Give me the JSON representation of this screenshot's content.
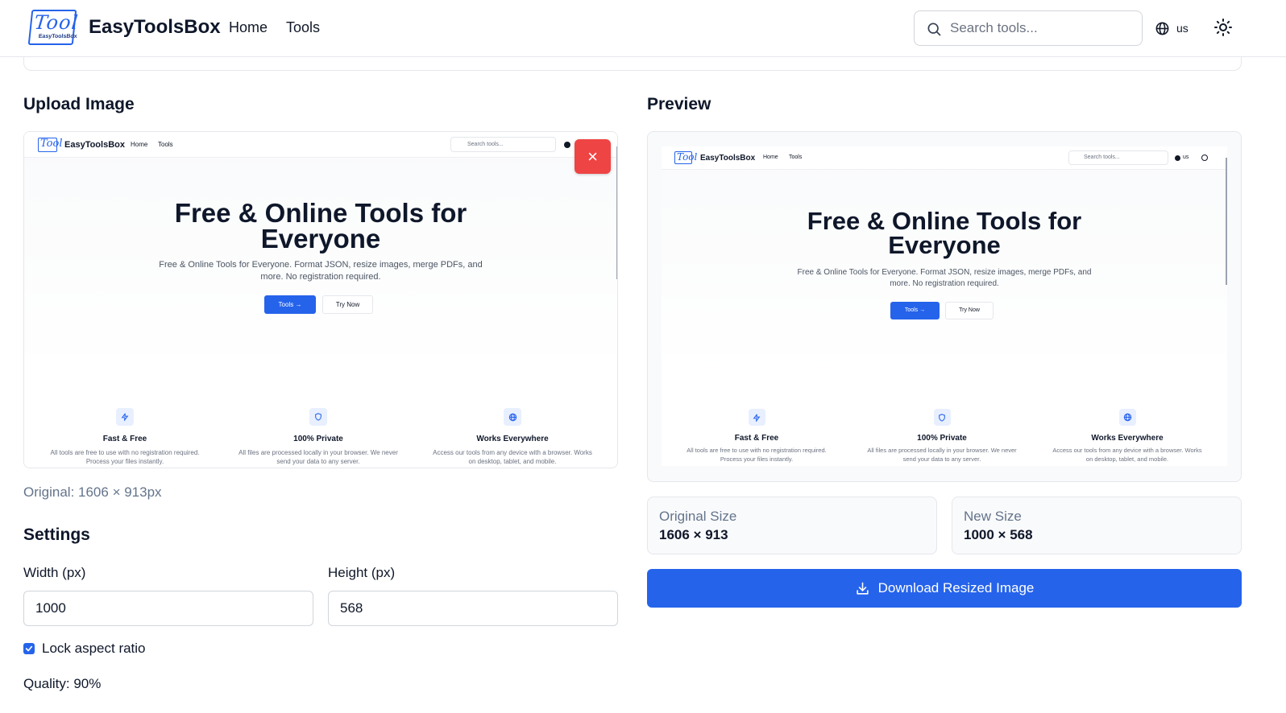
{
  "header": {
    "logo_text": "Tool",
    "logo_subtext": "EasyToolsBox",
    "brand": "EasyToolsBox",
    "nav": [
      {
        "label": "Home"
      },
      {
        "label": "Tools"
      }
    ],
    "search_placeholder": "Search tools...",
    "language": "us"
  },
  "upload": {
    "title": "Upload Image",
    "original_text": "Original: 1606 × 913px",
    "remove_icon": "×"
  },
  "preview": {
    "title": "Preview"
  },
  "screenshot": {
    "logo_text": "Tool",
    "brand": "EasyToolsBox",
    "nav_home": "Home",
    "nav_tools": "Tools",
    "search_placeholder": "Search tools...",
    "lang": "us",
    "hero_title_line1": "Free & Online Tools for",
    "hero_title_line2": "Everyone",
    "hero_sub_line1": "Free & Online Tools for Everyone. Format JSON, resize images, merge PDFs, and",
    "hero_sub_line2": "more. No registration required.",
    "btn_primary": "Tools →",
    "btn_secondary": "Try Now",
    "features": [
      {
        "title": "Fast & Free",
        "desc1": "All tools are free to use with no registration required.",
        "desc2": "Process your files instantly."
      },
      {
        "title": "100% Private",
        "desc1": "All files are processed locally in your browser. We never",
        "desc2": "send your data to any server."
      },
      {
        "title": "Works Everywhere",
        "desc1": "Access our tools from any device with a browser. Works",
        "desc2": "on desktop, tablet, and mobile."
      }
    ]
  },
  "settings": {
    "title": "Settings",
    "width_label": "Width (px)",
    "width_value": "1000",
    "height_label": "Height (px)",
    "height_value": "568",
    "lock_label": "Lock aspect ratio",
    "lock_checked": true,
    "quality_label": "Quality: 90%"
  },
  "stats": {
    "original_label": "Original Size",
    "original_value": "1606 × 913",
    "new_label": "New Size",
    "new_value": "1000 × 568"
  },
  "download_label": "Download Resized Image",
  "colors": {
    "accent": "#2563eb",
    "danger": "#ef4444",
    "muted": "#64748b"
  }
}
